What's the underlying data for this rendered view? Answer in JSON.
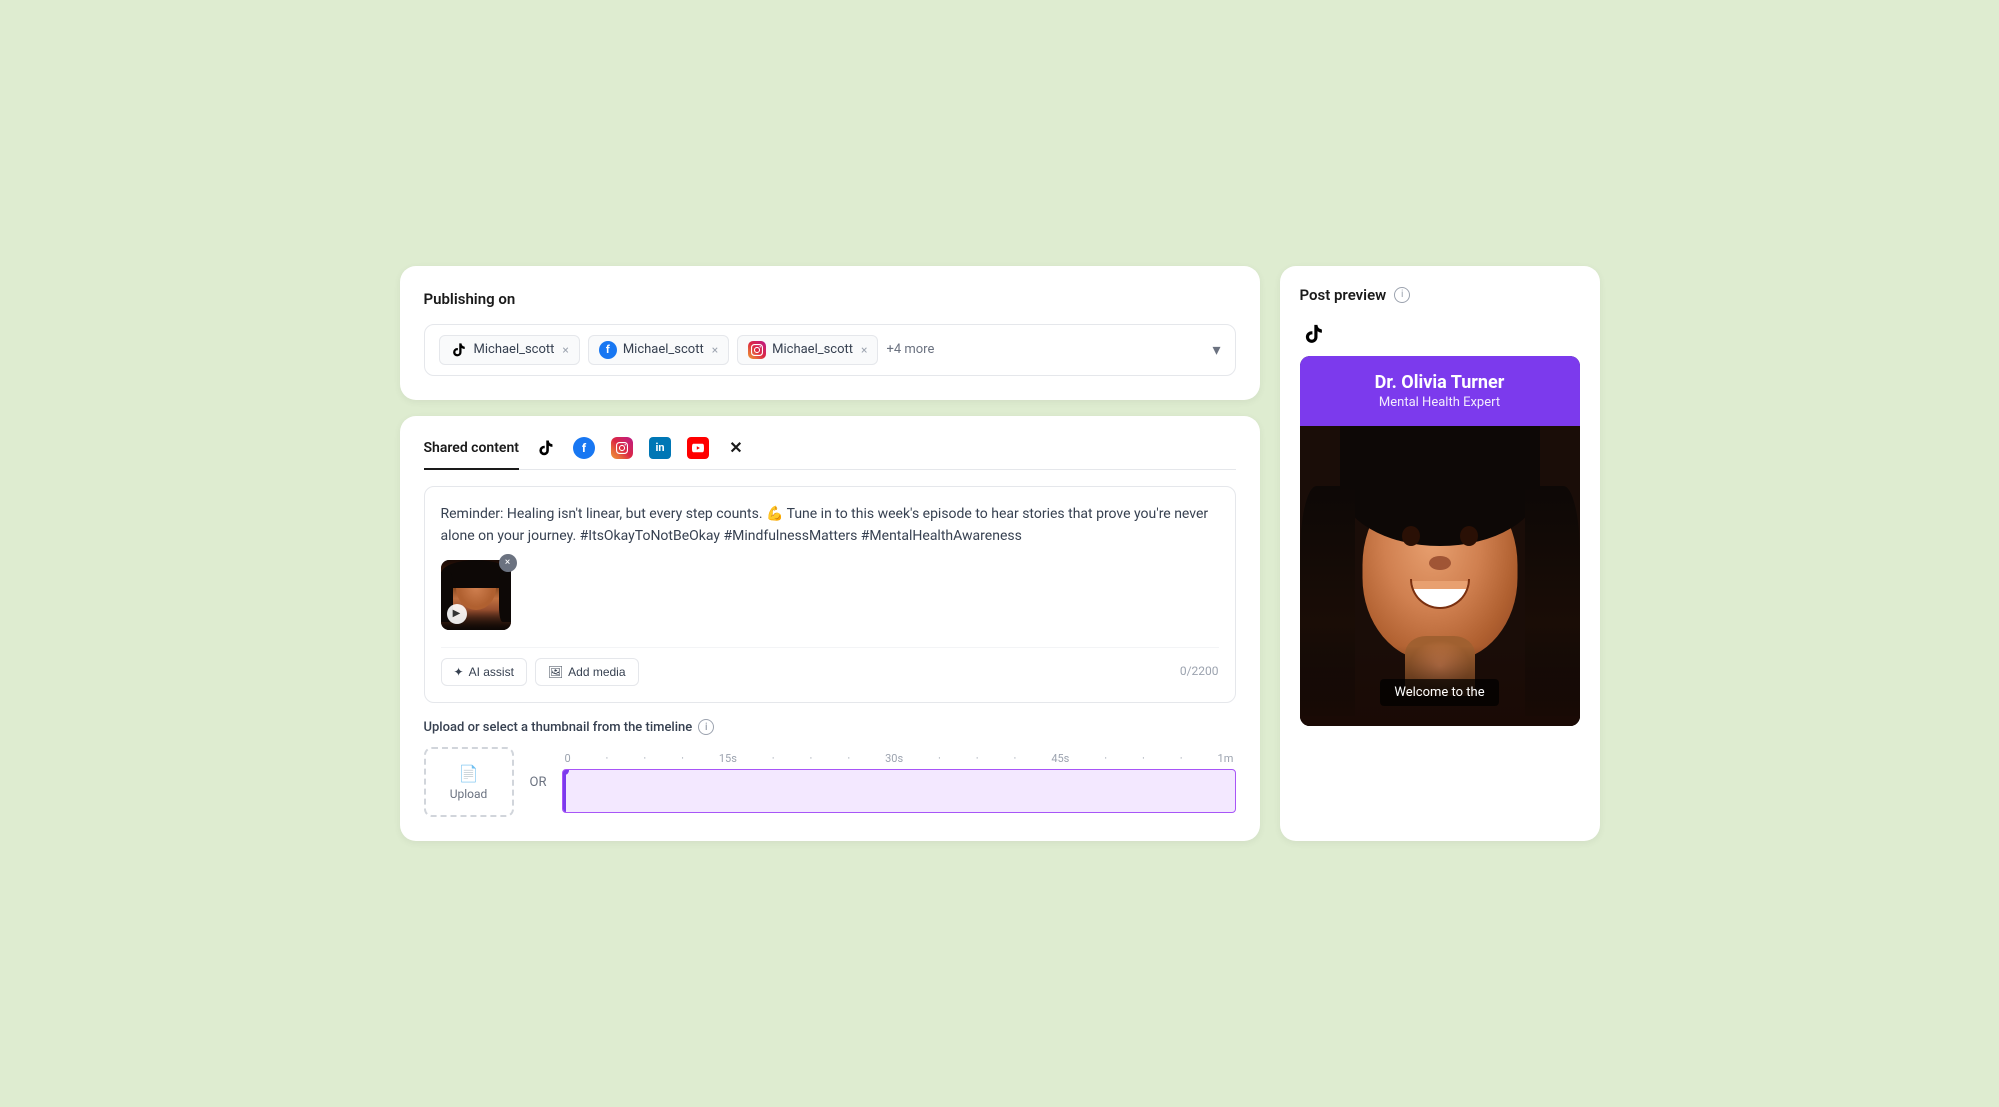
{
  "publishing": {
    "title": "Publishing on",
    "accounts": [
      {
        "platform": "tiktok",
        "name": "Michael_scott"
      },
      {
        "platform": "facebook",
        "name": "Michael_scott"
      },
      {
        "platform": "instagram",
        "name": "Michael_scott"
      }
    ],
    "more_label": "+4 more"
  },
  "content": {
    "shared_content_label": "Shared content",
    "tabs": [
      "tiktok",
      "facebook",
      "instagram",
      "linkedin",
      "youtube",
      "x"
    ],
    "body_text": "Reminder: Healing isn't linear, but every step counts. 💪 Tune in to this week's episode to hear stories that prove you're never alone on your journey. #ItsOkayToNotBeOkay #MindfulnessMatters #MentalHealthAwareness",
    "ai_assist_label": "AI assist",
    "add_media_label": "Add media",
    "char_count": "0/2200"
  },
  "thumbnail": {
    "label": "Upload or select a thumbnail from the timeline",
    "upload_label": "Upload",
    "or_label": "OR",
    "timeline_marks": [
      "0",
      "15s",
      "30s",
      "45s",
      "1m"
    ]
  },
  "preview": {
    "title": "Post preview",
    "platform": "tiktok",
    "person_name": "Dr. Olivia Turner",
    "person_subtitle": "Mental Health Expert",
    "welcome_text": "Welcome to the"
  }
}
